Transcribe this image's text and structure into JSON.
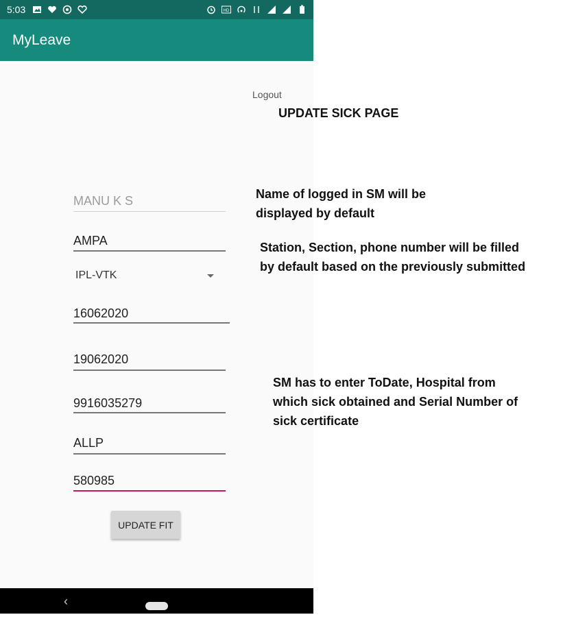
{
  "status_bar": {
    "time": "5:03"
  },
  "app_bar": {
    "title": "MyLeave"
  },
  "logout": "Logout",
  "page_heading": "UPDATE SICK PAGE",
  "form": {
    "name_hint": "MANU K S",
    "station": "AMPA",
    "section": "IPL-VTK",
    "from_date": "16062020",
    "to_date": "19062020",
    "phone": "9916035279",
    "hospital": "ALLP",
    "serial_number": "580985",
    "submit_label": "UPDATE FIT"
  },
  "annotations": {
    "name_line1": "Name of logged in SM will be",
    "name_line2": "displayed by default",
    "station_line1": "Station, Section, phone number will be filled",
    "station_line2": "by default based on the previously submitted",
    "sm_line1": "SM has to enter ToDate, Hospital from",
    "sm_line2": "which sick obtained and Serial Number of",
    "sm_line3": "sick certificate"
  },
  "colors": {
    "status_bar": "#13695f",
    "app_bar": "#168a7c",
    "accent": "#c2185b"
  }
}
